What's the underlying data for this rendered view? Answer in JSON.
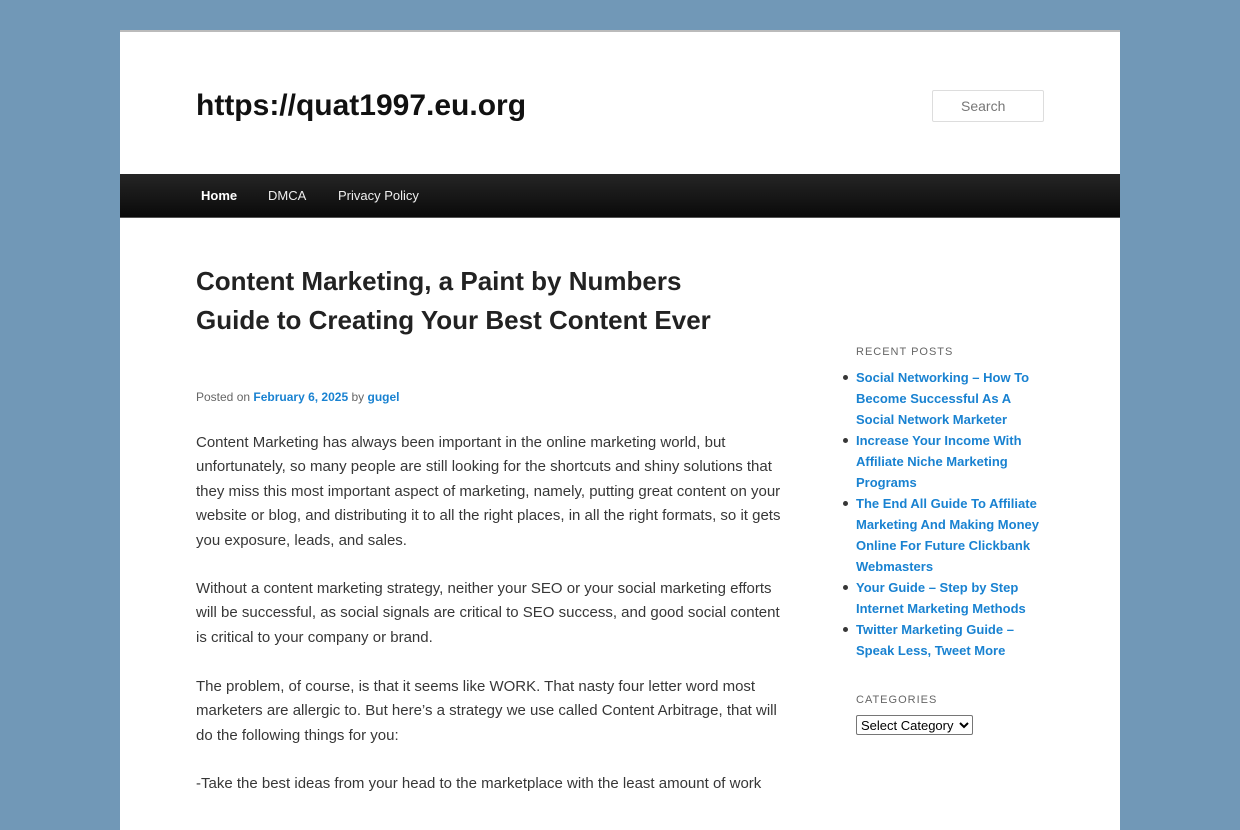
{
  "site": {
    "title": "https://quat1997.eu.org"
  },
  "search": {
    "placeholder": "Search"
  },
  "nav": {
    "items": [
      {
        "label": "Home"
      },
      {
        "label": "DMCA"
      },
      {
        "label": "Privacy Policy"
      }
    ]
  },
  "post": {
    "title": "Content Marketing, a Paint by Numbers Guide to Creating Your Best Content Ever",
    "posted_on": "Posted on",
    "date": "February 6, 2025",
    "by": "by",
    "author": "gugel",
    "paragraphs": [
      "Content Marketing has always been important in the online marketing world, but unfortunately, so many people are still looking for the shortcuts and shiny solutions that they miss this most important aspect of marketing, namely, putting great content on your website or blog, and distributing it to all the right places, in all the right formats, so it gets you exposure, leads, and sales.",
      "Without a content marketing strategy, neither your SEO or your social marketing efforts will be successful, as social signals are critical to SEO success, and good social content is critical to your company or brand.",
      "The problem, of course, is that it seems like WORK. That nasty four letter word most marketers are allergic to. But here’s a strategy we use called Content Arbitrage, that will do the following things for you:",
      "-Take the best ideas from your head to the marketplace with the least amount of work"
    ]
  },
  "sidebar": {
    "recent_posts_title": "Recent Posts",
    "recent_posts": [
      "Social Networking – How To Become Successful As A Social Network Marketer",
      "Increase Your Income With Affiliate Niche Marketing Programs",
      "The End All Guide To Affiliate Marketing And Making Money Online For Future Clickbank Webmasters",
      "Your Guide – Step by Step Internet Marketing Methods",
      "Twitter Marketing Guide – Speak Less, Tweet More"
    ],
    "categories_title": "Categories",
    "categories_select": "Select Category"
  },
  "colors": {
    "background": "#7198b7",
    "link": "#1982d1",
    "nav": "#111111"
  }
}
